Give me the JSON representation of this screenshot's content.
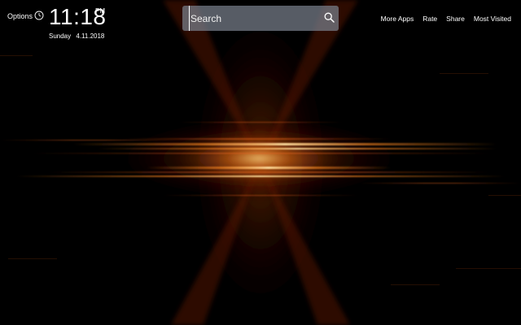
{
  "header": {
    "options_label": "Options",
    "clock": {
      "time": "11:18",
      "ampm": "PM",
      "weekday": "Sunday",
      "date": "4.11.2018"
    },
    "search": {
      "placeholder": "Search"
    },
    "nav": [
      {
        "label": "More Apps"
      },
      {
        "label": "Rate"
      },
      {
        "label": "Share"
      },
      {
        "label": "Most Visited"
      }
    ]
  },
  "wallpaper": {
    "icon": "abstract-light-burst",
    "colors": {
      "background": "#000000",
      "core": "#ffd27a",
      "glow": "#ff7a1a",
      "ember": "#7a1e08"
    }
  }
}
